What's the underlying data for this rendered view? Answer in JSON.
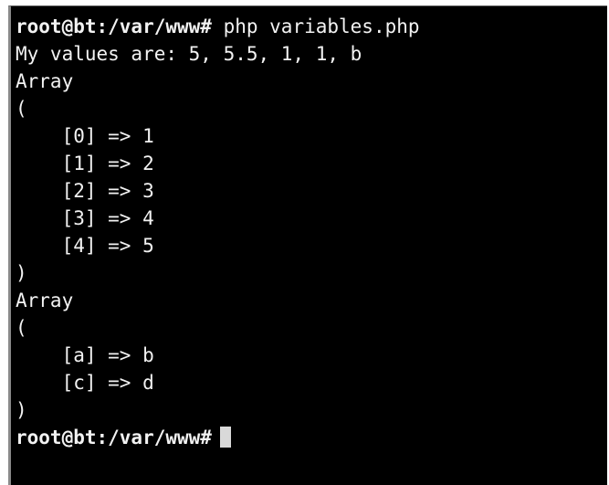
{
  "terminal": {
    "prompt": "root@bt:/var/www#",
    "command": "php variables.php",
    "output_lines": [
      "My values are: 5, 5.5, 1, 1, b",
      "Array",
      "(",
      "    [0] => 1",
      "    [1] => 2",
      "    [2] => 3",
      "    [3] => 4",
      "    [4] => 5",
      ")",
      "Array",
      "(",
      "    [a] => b",
      "    [c] => d",
      ")"
    ],
    "final_prompt": "root@bt:/var/www#",
    "colors": {
      "background": "#000000",
      "text": "#f2f2f2",
      "cursor": "#d9d9d9"
    }
  }
}
